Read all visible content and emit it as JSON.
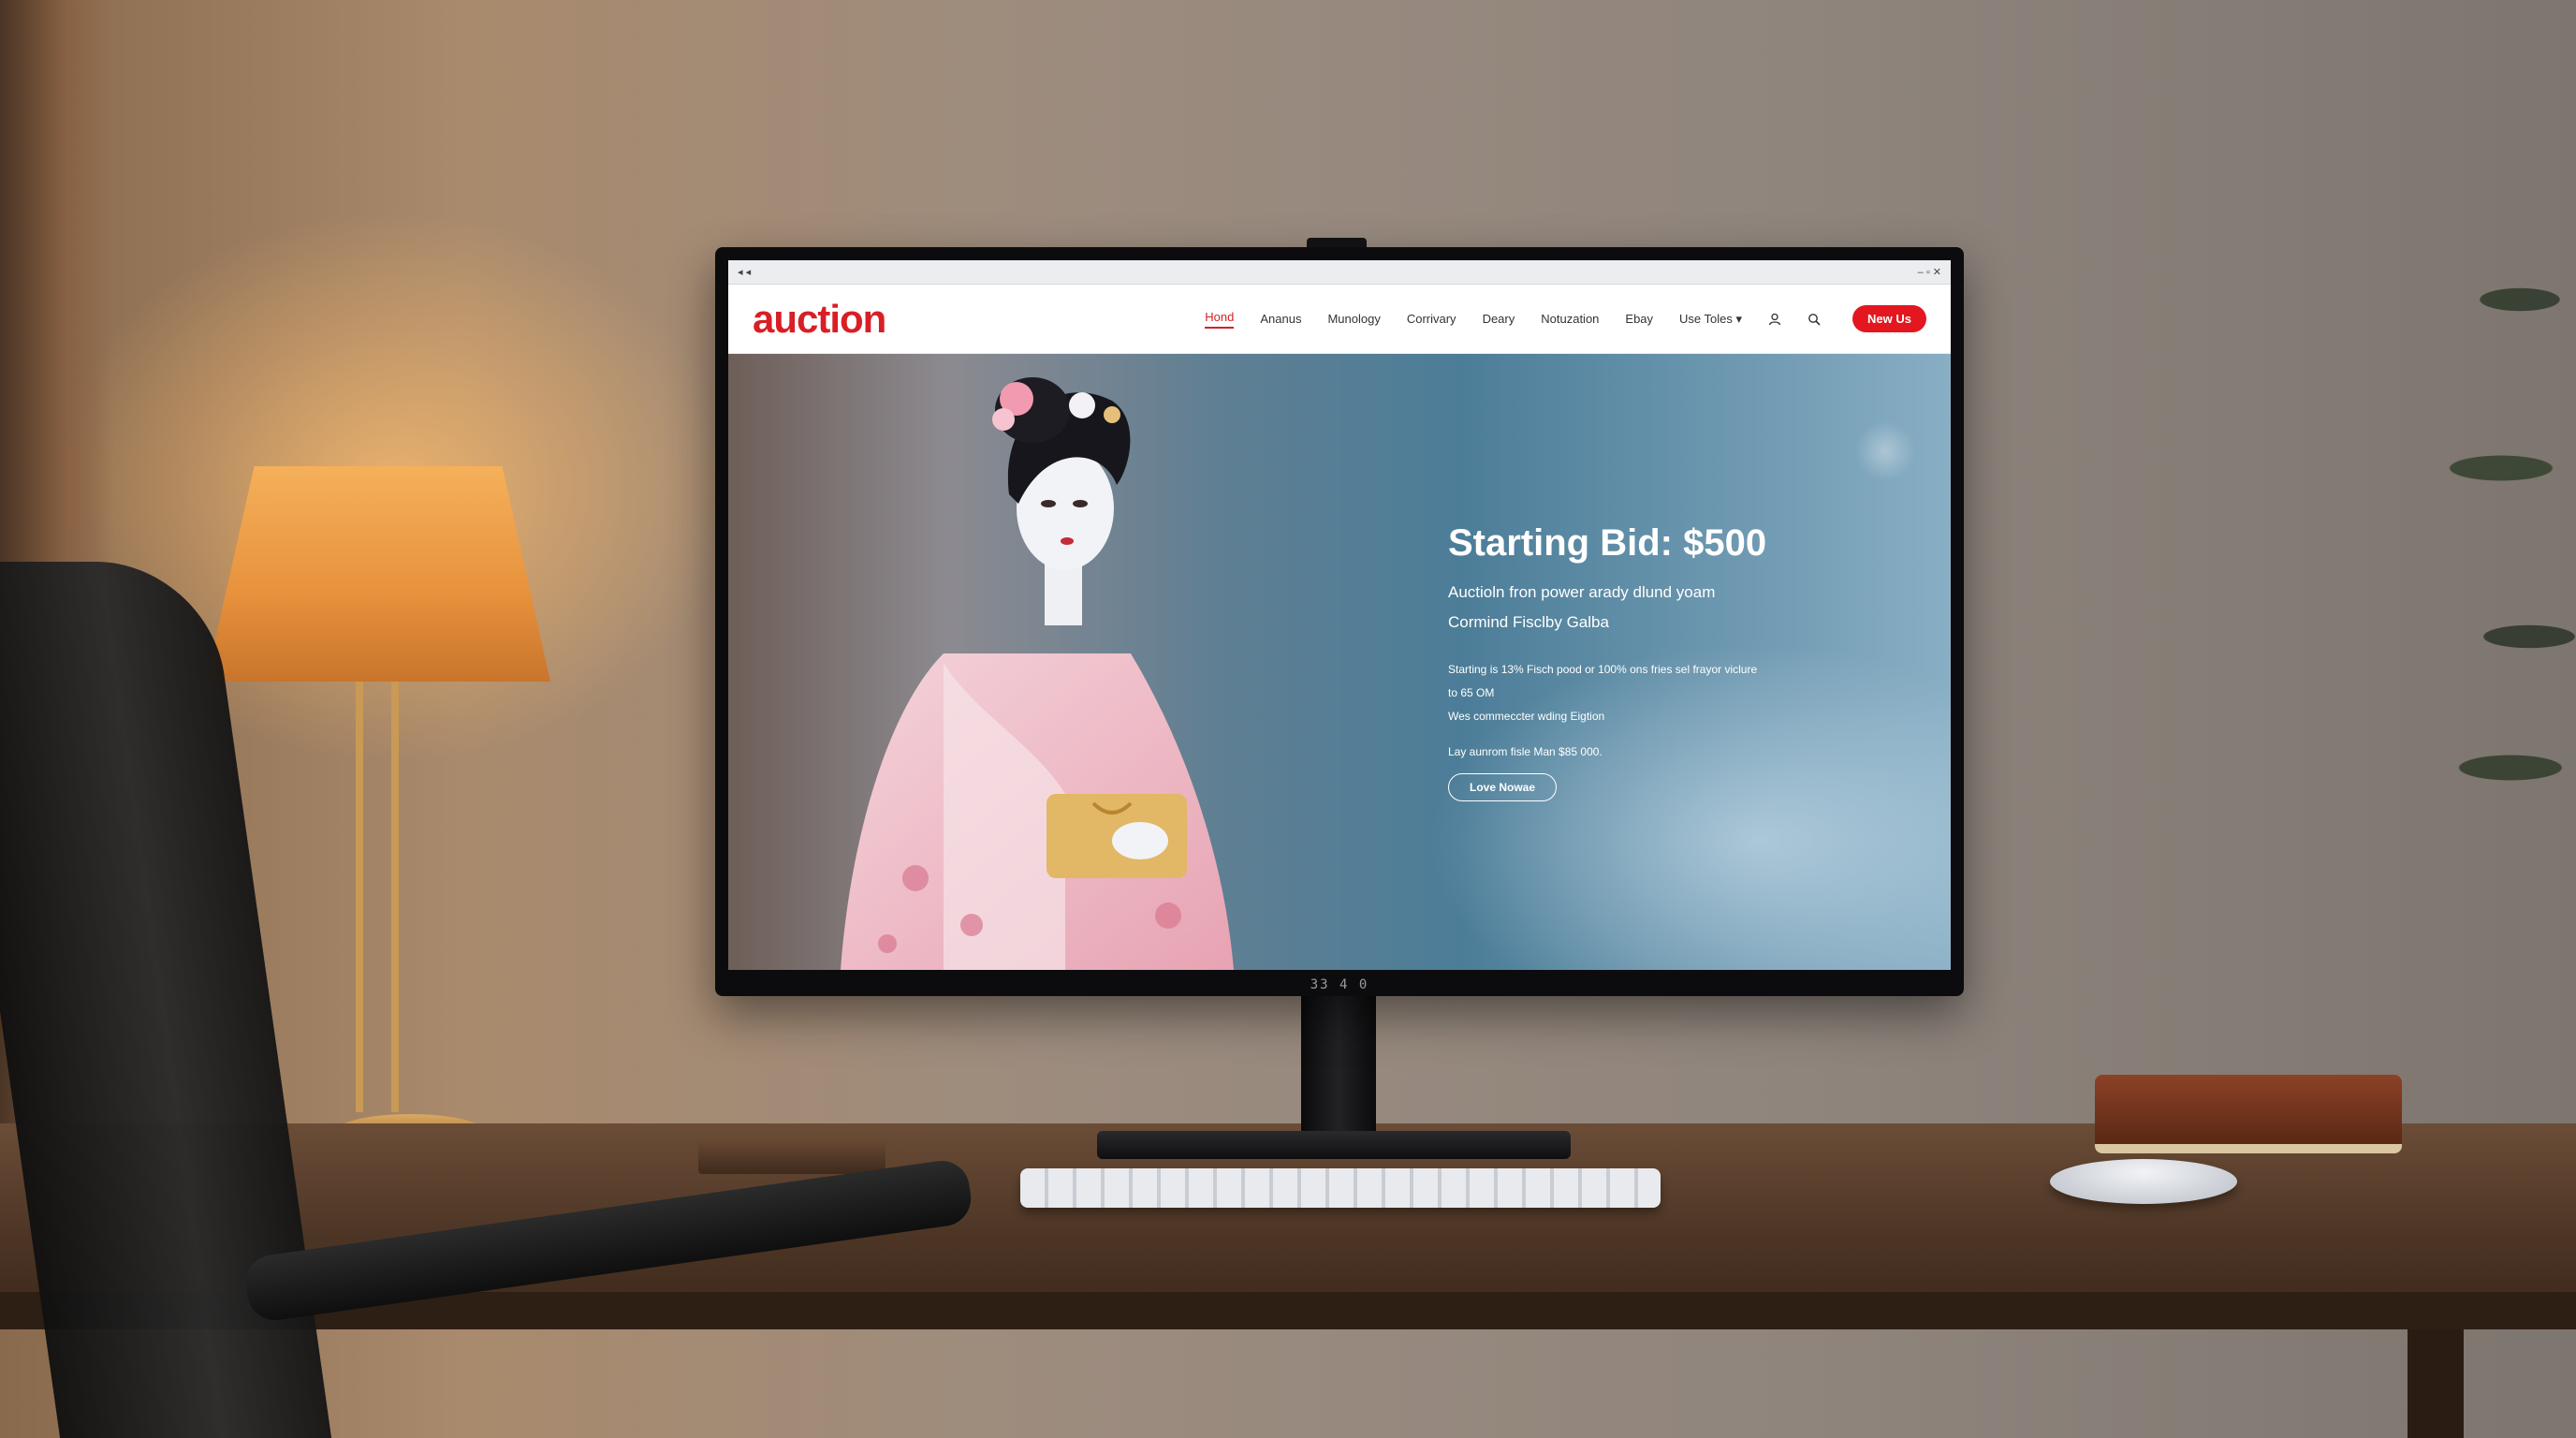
{
  "browser": {
    "back_forward": "◂ ◂",
    "window_controls": "‒ ▫ ✕"
  },
  "site": {
    "logo": "auction",
    "accent_color": "#d81f26"
  },
  "nav": {
    "items": [
      "Hond",
      "Ananus",
      "Munology",
      "Corrivary",
      "Deary",
      "Notuzation",
      "Ebay",
      "Use Toles ▾"
    ],
    "active_index": 0,
    "user_icon": "user-icon",
    "search_icon": "search-icon",
    "cta_label": "New Us"
  },
  "hero": {
    "title": "Starting Bid: $500",
    "subtitle_line1": "Auctioln fron power arady dlund yoam",
    "subtitle_line2": "Cormind Fisclby Galba",
    "detail_line1": "Starting is 13% Fisch pood or 100% ons fries sel frayor viclure",
    "detail_line2": "to 65 OM",
    "detail_line3": "Wes commeccter wding Eigtion",
    "note": "Lay aunrom fisle Man $85 000.",
    "button_label": "Love Nowae"
  },
  "monitor": {
    "label": "33 4 0"
  }
}
